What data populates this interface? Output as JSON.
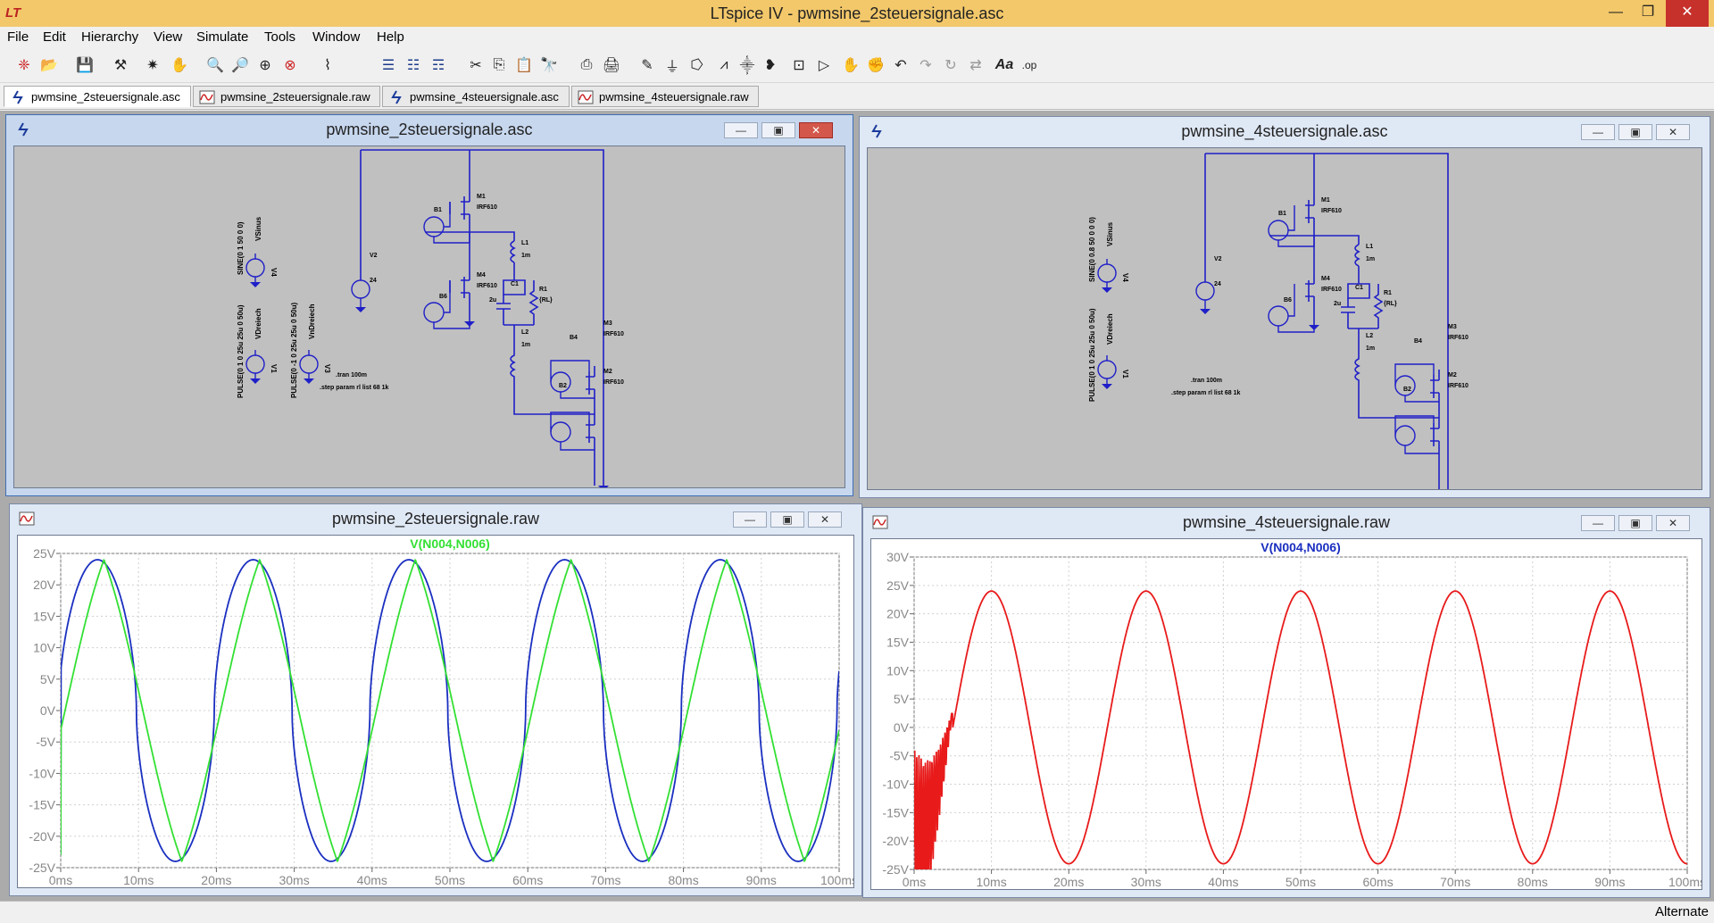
{
  "app": {
    "title": "LTspice IV - pwmsine_2steuersignale.asc",
    "status": "Alternate",
    "colors": {
      "titlebar": "#f3c86a",
      "wire": "#1f1fc8",
      "trace_blue": "#1a2fc0",
      "trace_green": "#33e033",
      "trace_red": "#e81a1a"
    }
  },
  "window_controls": {
    "minimize": "—",
    "maximize": "❐",
    "close": "✕"
  },
  "menu": [
    "File",
    "Edit",
    "Hierarchy",
    "View",
    "Simulate",
    "Tools",
    "Window",
    "Help"
  ],
  "toolbar_icons": [
    "new-schematic-icon",
    "open-icon",
    "save-icon",
    "control-panel-icon",
    "run-icon",
    "halt-icon",
    "zoom-in-icon",
    "zoom-out-icon",
    "zoom-fit-icon",
    "zoom-cancel-icon",
    "autoscale-icon",
    "tile-horizontal-icon",
    "cascade-icon",
    "tile-vertical-icon",
    "cut-icon",
    "copy-icon",
    "paste-icon",
    "find-icon",
    "print-preview-icon",
    "print-icon",
    "wire-icon",
    "ground-icon",
    "label-icon",
    "resistor-icon",
    "capacitor-icon",
    "inductor-icon",
    "diode-icon",
    "component-icon",
    "move-icon",
    "drag-icon",
    "undo-icon",
    "redo-icon",
    "rotate-icon",
    "mirror-icon",
    "text-icon",
    "spice-directive-icon"
  ],
  "tabs": [
    {
      "label": "pwmsine_2steuersignale.asc",
      "kind": "schematic",
      "active": true
    },
    {
      "label": "pwmsine_2steuersignale.raw",
      "kind": "waveform",
      "active": false
    },
    {
      "label": "pwmsine_4steuersignale.asc",
      "kind": "schematic",
      "active": false
    },
    {
      "label": "pwmsine_4steuersignale.raw",
      "kind": "waveform",
      "active": false
    }
  ],
  "windows": {
    "sch2": {
      "title": "pwmsine_2steuersignale.asc",
      "sources": [
        {
          "value": "SINE(0 1 50 0 0)",
          "name": "VSinus",
          "ref": "V4"
        },
        {
          "value": "PULSE(0 1 0 25u 25u 0 50u)",
          "name": "VDreiech",
          "ref": "V1"
        },
        {
          "value": "PULSE(0 -1 0 25u 25u 0 50u)",
          "name": "VnDreiech",
          "ref": "V3"
        }
      ],
      "supply": {
        "ref": "V2",
        "value": "24"
      },
      "parts": {
        "m1": "M1",
        "m4": "M4",
        "m3": "M3",
        "m2": "M2",
        "model": "IRF610",
        "b1": "B1",
        "b6": "B6",
        "b4": "B4",
        "b2": "B2",
        "l1": "L1",
        "l2": "L2",
        "lval": "1m",
        "c1": "C1",
        "cval": "2u",
        "r1": "R1",
        "rval": "{RL}"
      },
      "directives": [
        ".tran 100m",
        ".step param rl list 68 1k"
      ]
    },
    "sch4": {
      "title": "pwmsine_4steuersignale.asc",
      "sources": [
        {
          "value": "SINE(0 0.8 50 0 0 0)",
          "name": "VSinus",
          "ref": "V4"
        },
        {
          "value": "PULSE(0 1 0 25u 25u 0 50u)",
          "name": "VDreiech",
          "ref": "V1"
        }
      ],
      "supply": {
        "ref": "V2",
        "value": "24"
      },
      "parts": {
        "m1": "M1",
        "m4": "M4",
        "m3": "M3",
        "m2": "M2",
        "model": "IRF610",
        "b1": "B1",
        "b6": "B6",
        "b4": "B4",
        "b2": "B2",
        "l1": "L1",
        "l2": "L2",
        "lval": "1m",
        "c1": "C1",
        "cval": "2u",
        "r1": "R1",
        "rval": "{RL}"
      },
      "directives": [
        ".tran 100m",
        ".step param rl list 68 1k"
      ]
    },
    "raw2": {
      "title": "pwmsine_2steuersignale.raw"
    },
    "raw4": {
      "title": "pwmsine_4steuersignale.raw"
    }
  },
  "chart_data": [
    {
      "type": "line",
      "title": "V(N004,N006)",
      "title_color": "#33e033",
      "xlim": [
        0,
        100
      ],
      "ylim": [
        -25,
        25
      ],
      "x_ticks": [
        "0ms",
        "10ms",
        "20ms",
        "30ms",
        "40ms",
        "50ms",
        "60ms",
        "70ms",
        "80ms",
        "90ms",
        "100ms"
      ],
      "y_ticks": [
        "25V",
        "20V",
        "15V",
        "10V",
        "5V",
        "0V",
        "-5V",
        "-10V",
        "-15V",
        "-20V",
        "-25V"
      ],
      "grid": true,
      "series": [
        {
          "color": "#1a2fc0",
          "amplitude": 24,
          "period_ms": 20,
          "phase_deg": 5,
          "shape": "squarish-sine",
          "start_ms": 0
        },
        {
          "color": "#33e033",
          "amplitude": 24,
          "period_ms": 20,
          "phase_deg": -10,
          "shape": "triangle-like",
          "start_ms": 0
        }
      ]
    },
    {
      "type": "line",
      "title": "V(N004,N006)",
      "title_color": "#1a2fc0",
      "xlim": [
        0,
        100
      ],
      "ylim": [
        -25,
        30
      ],
      "x_ticks": [
        "0ms",
        "10ms",
        "20ms",
        "30ms",
        "40ms",
        "50ms",
        "60ms",
        "70ms",
        "80ms",
        "90ms",
        "100ms"
      ],
      "y_ticks": [
        "30V",
        "25V",
        "20V",
        "15V",
        "10V",
        "5V",
        "0V",
        "-5V",
        "-10V",
        "-15V",
        "-20V",
        "-25V"
      ],
      "grid": true,
      "series": [
        {
          "color": "#e81a1a",
          "amplitude": 24,
          "period_ms": 20,
          "phase_deg": -90,
          "shape": "sine",
          "start_ms": 0,
          "startup_ringing_ms": 5
        }
      ]
    }
  ]
}
